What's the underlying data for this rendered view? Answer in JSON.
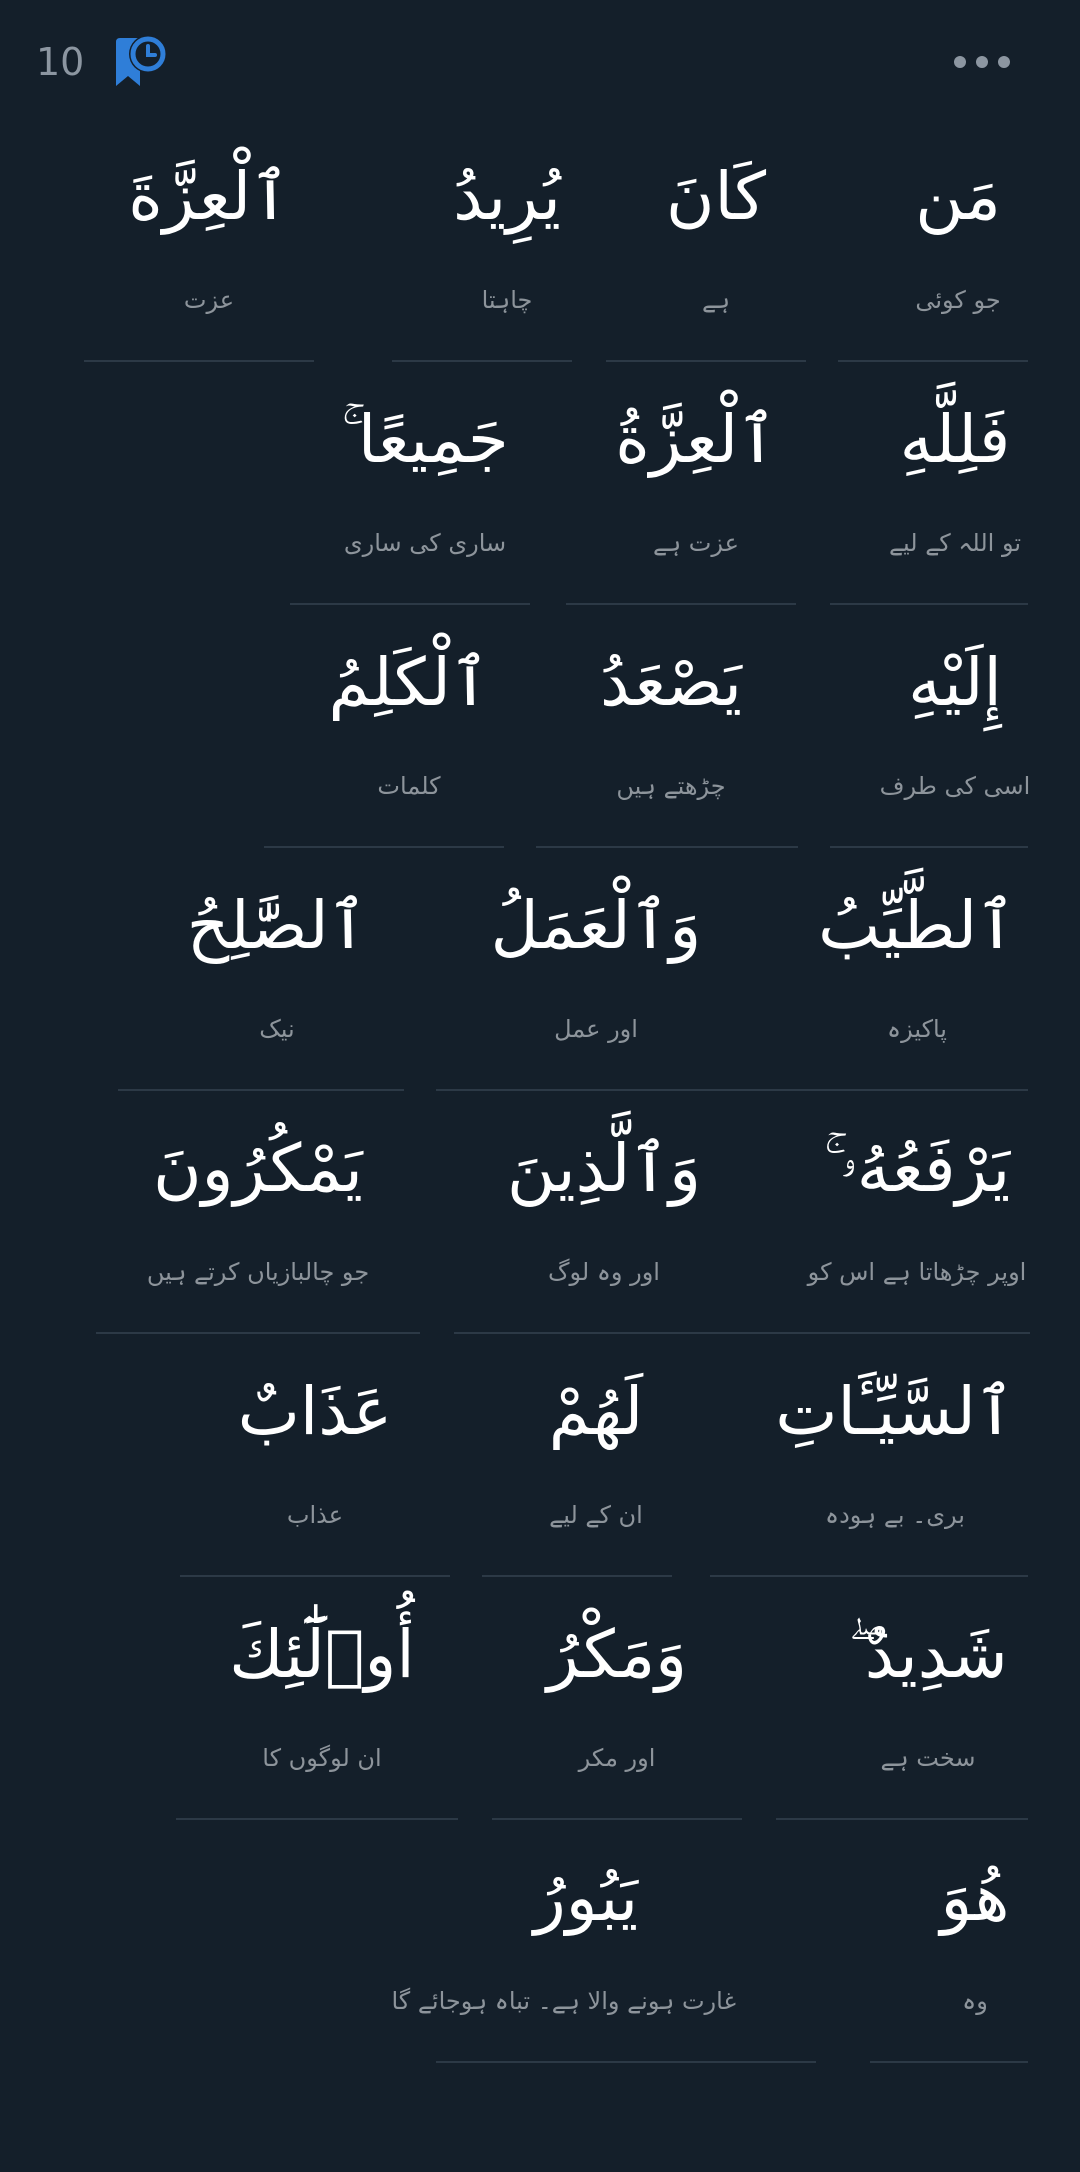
{
  "header": {
    "verse_number": "10",
    "bookmark_icon": "bookmark-clock-icon",
    "menu_icon": "more-dots-icon",
    "accent_color": "#2f7ed8"
  },
  "rows": [
    {
      "words": [
        {
          "arabic": "مَن",
          "urdu": "جو کوئی"
        },
        {
          "arabic": "كَانَ",
          "urdu": "ہے"
        },
        {
          "arabic": "يُرِيدُ",
          "urdu": "چاہتا"
        },
        {
          "arabic": "ٱلْعِزَّةَ",
          "urdu": "عزت"
        }
      ]
    },
    {
      "words": [
        {
          "arabic": "فَلِلَّهِ",
          "urdu": "تو اللہ کے لیے"
        },
        {
          "arabic": "ٱلْعِزَّةُ",
          "urdu": "عزت ہے"
        },
        {
          "arabic": "جَمِيعًا ۚ",
          "urdu": "ساری کی ساری"
        }
      ]
    },
    {
      "words": [
        {
          "arabic": "إِلَيْهِ",
          "urdu": "اسی کی طرف"
        },
        {
          "arabic": "يَصْعَدُ",
          "urdu": "چڑھتے ہیں"
        },
        {
          "arabic": "ٱلْكَلِمُ",
          "urdu": "کلمات"
        }
      ]
    },
    {
      "words": [
        {
          "arabic": "ٱلطَّيِّبُ",
          "urdu": "پاکیزہ"
        },
        {
          "arabic": "وَٱلْعَمَلُ",
          "urdu": "اور عمل"
        },
        {
          "arabic": "ٱلصَّٰلِحُ",
          "urdu": "نیک"
        }
      ]
    },
    {
      "words": [
        {
          "arabic": "يَرْفَعُهُۥ ۚ",
          "urdu": "اوپر چڑھاتا ہے اس کو"
        },
        {
          "arabic": "وَٱلَّذِينَ",
          "urdu": "اور وہ لوگ"
        },
        {
          "arabic": "يَمْكُرُونَ",
          "urdu": "جو چالبازیاں کرتے ہیں"
        }
      ]
    },
    {
      "words": [
        {
          "arabic": "ٱلسَّيِّـَٔاتِ",
          "urdu": "بری۔ بے ہودہ"
        },
        {
          "arabic": "لَهُمْ",
          "urdu": "ان کے لیے"
        },
        {
          "arabic": "عَذَابٌ",
          "urdu": "عذاب"
        }
      ]
    },
    {
      "words": [
        {
          "arabic": "شَدِيدٌ ۖ",
          "urdu": "سخت ہے"
        },
        {
          "arabic": "وَمَكْرُ",
          "urdu": "اور مکر"
        },
        {
          "arabic": "أُو۟لَٰٓئِكَ",
          "urdu": "ان لوگوں کا"
        }
      ]
    },
    {
      "words": [
        {
          "arabic": "هُوَ",
          "urdu": "وہ"
        },
        {
          "arabic": "يَبُورُ",
          "urdu": "غارت ہونے والا ہے۔ تباہ ہوجائے گا"
        }
      ]
    }
  ]
}
